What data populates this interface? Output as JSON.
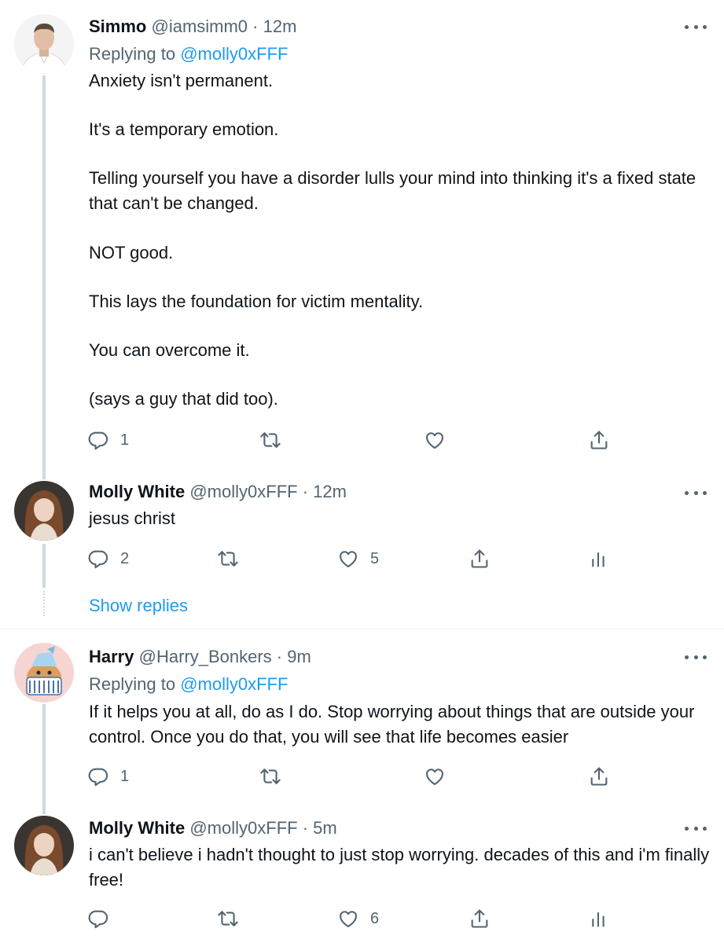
{
  "tweets": [
    {
      "name": "Simmo",
      "handle": "@iamsimm0",
      "dot": "·",
      "time": "12m",
      "replying_prefix": "Replying to",
      "replying_to": "@molly0xFFF",
      "body": [
        "Anxiety isn't permanent.",
        "It's a temporary emotion.",
        "Telling yourself you have a disorder lulls your mind into thinking it's a fixed state that can't be changed.",
        "NOT good.",
        "This lays the foundation for victim mentality.",
        "You can overcome it.",
        "(says a guy that did too)."
      ],
      "reply_count": "1",
      "retweet_count": "",
      "like_count": "",
      "avatar": "man-avatar"
    },
    {
      "name": "Molly White",
      "handle": "@molly0xFFF",
      "dot": "·",
      "time": "12m",
      "body": [
        "jesus christ"
      ],
      "reply_count": "2",
      "retweet_count": "",
      "like_count": "5",
      "avatar": "woman-avatar"
    },
    {
      "name": "Harry",
      "handle": "@Harry_Bonkers",
      "dot": "·",
      "time": "9m",
      "replying_prefix": "Replying to",
      "replying_to": "@molly0xFFF",
      "body": [
        "If it helps you at all, do as I do. Stop worrying about things that are outside your control. Once you do that, you will see that life becomes easier"
      ],
      "reply_count": "1",
      "retweet_count": "",
      "like_count": "",
      "avatar": "cartoon-dog-avatar"
    },
    {
      "name": "Molly White",
      "handle": "@molly0xFFF",
      "dot": "·",
      "time": "5m",
      "body": [
        "i can't believe i hadn't thought to just stop worrying. decades of this and i'm finally free!"
      ],
      "reply_count": "",
      "retweet_count": "",
      "like_count": "6",
      "avatar": "woman-avatar"
    }
  ],
  "show_replies": "Show replies",
  "colors": {
    "text": "#0f1419",
    "secondary": "#536471",
    "accent": "#1d9bf0",
    "thread_line": "#cfd9de"
  },
  "icons": [
    "reply-icon",
    "retweet-icon",
    "like-icon",
    "share-icon",
    "analytics-icon",
    "more-icon"
  ]
}
